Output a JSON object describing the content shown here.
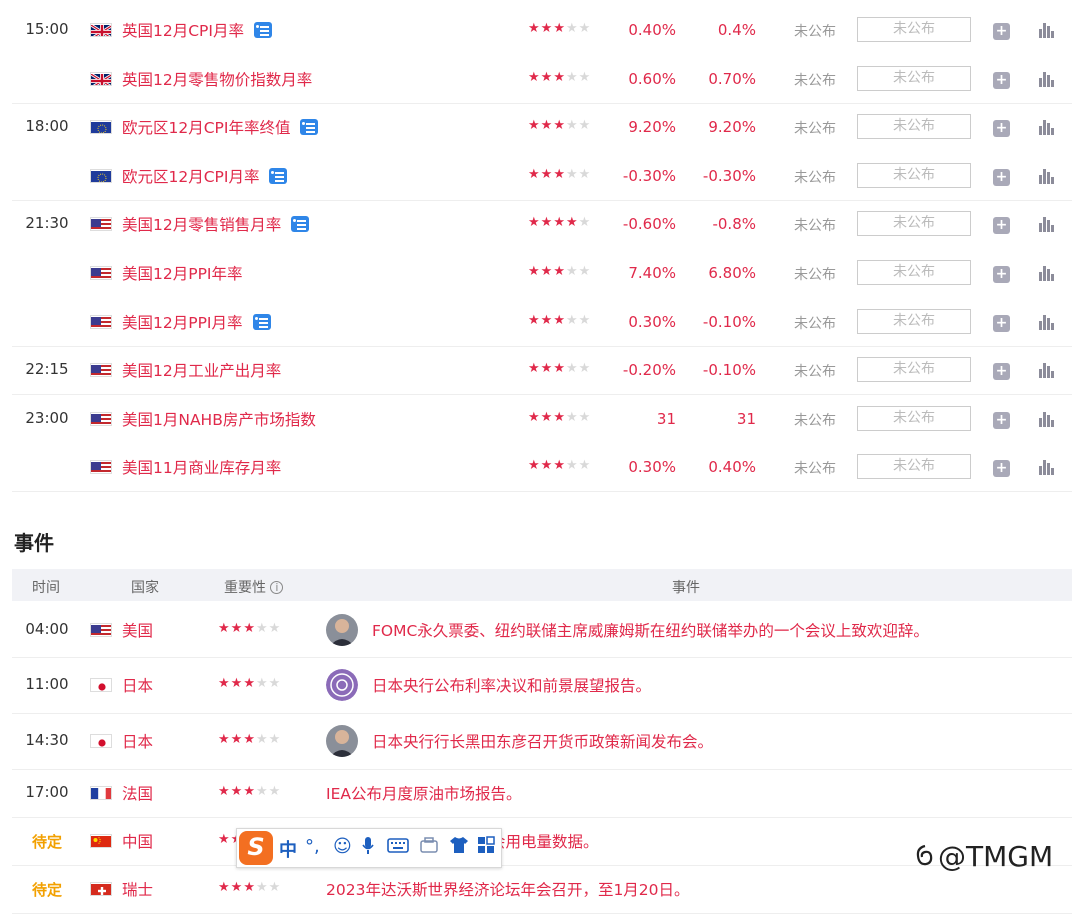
{
  "econ_rows": [
    {
      "time": "15:00",
      "flag": "uk",
      "name": "英国12月CPI月率",
      "tip": true,
      "stars": 3,
      "prev": "0.40%",
      "forecast": "0.4%",
      "actual": "未公布",
      "input": "未公布"
    },
    {
      "time": "",
      "flag": "uk",
      "name": "英国12月零售物价指数月率",
      "tip": false,
      "stars": 3,
      "prev": "0.60%",
      "forecast": "0.70%",
      "actual": "未公布",
      "input": "未公布"
    },
    {
      "time": "18:00",
      "flag": "eu",
      "name": "欧元区12月CPI年率终值",
      "tip": true,
      "stars": 3,
      "prev": "9.20%",
      "forecast": "9.20%",
      "actual": "未公布",
      "input": "未公布"
    },
    {
      "time": "",
      "flag": "eu",
      "name": "欧元区12月CPI月率",
      "tip": true,
      "stars": 3,
      "prev": "-0.30%",
      "forecast": "-0.30%",
      "actual": "未公布",
      "input": "未公布"
    },
    {
      "time": "21:30",
      "flag": "us",
      "name": "美国12月零售销售月率",
      "tip": true,
      "stars": 4,
      "prev": "-0.60%",
      "forecast": "-0.8%",
      "actual": "未公布",
      "input": "未公布"
    },
    {
      "time": "",
      "flag": "us",
      "name": "美国12月PPI年率",
      "tip": false,
      "stars": 3,
      "prev": "7.40%",
      "forecast": "6.80%",
      "actual": "未公布",
      "input": "未公布"
    },
    {
      "time": "",
      "flag": "us",
      "name": "美国12月PPI月率",
      "tip": true,
      "stars": 3,
      "prev": "0.30%",
      "forecast": "-0.10%",
      "actual": "未公布",
      "input": "未公布"
    },
    {
      "time": "22:15",
      "flag": "us",
      "name": "美国12月工业产出月率",
      "tip": false,
      "stars": 3,
      "prev": "-0.20%",
      "forecast": "-0.10%",
      "actual": "未公布",
      "input": "未公布"
    },
    {
      "time": "23:00",
      "flag": "us",
      "name": "美国1月NAHB房产市场指数",
      "tip": false,
      "stars": 3,
      "prev": "31",
      "forecast": "31",
      "actual": "未公布",
      "input": "未公布"
    },
    {
      "time": "",
      "flag": "us",
      "name": "美国11月商业库存月率",
      "tip": false,
      "stars": 3,
      "prev": "0.30%",
      "forecast": "0.40%",
      "actual": "未公布",
      "input": "未公布"
    }
  ],
  "events_section": {
    "title": "事件",
    "headers": {
      "time": "时间",
      "country": "国家",
      "importance": "重要性",
      "event": "事件"
    },
    "rows": [
      {
        "time": "04:00",
        "pending": false,
        "flag": "us",
        "country": "美国",
        "stars": 3,
        "avatar": "person",
        "text": "FOMC永久票委、纽约联储主席威廉姆斯在纽约联储举办的一个会议上致欢迎辞。"
      },
      {
        "time": "11:00",
        "pending": false,
        "flag": "jp",
        "country": "日本",
        "stars": 3,
        "avatar": "seal",
        "text": "日本央行公布利率决议和前景展望报告。"
      },
      {
        "time": "14:30",
        "pending": false,
        "flag": "jp",
        "country": "日本",
        "stars": 3,
        "avatar": "person",
        "text": "日本央行行长黑田东彦召开货币政策新闻发布会。"
      },
      {
        "time": "17:00",
        "pending": false,
        "flag": "fr",
        "country": "法国",
        "stars": 3,
        "avatar": "",
        "text": "IEA公布月度原油市场报告。"
      },
      {
        "time": "待定",
        "pending": true,
        "flag": "cn",
        "country": "中国",
        "stars": 3,
        "avatar": "",
        "text": "发布全社会用电量数据。"
      },
      {
        "time": "待定",
        "pending": true,
        "flag": "ch",
        "country": "瑞士",
        "stars": 3,
        "avatar": "",
        "text": "2023年达沃斯世界经济论坛年会召开，至1月20日。"
      }
    ]
  },
  "ime_toolbar": {
    "logo": "S",
    "mode": "中",
    "punct": "°,",
    "icons": [
      "emoji-icon",
      "mic-icon",
      "keyboard-icon",
      "toolbox-icon",
      "skin-icon",
      "grid-icon"
    ]
  },
  "brand_watermark": "@TMGM",
  "colors": {
    "accent": "#e0294a",
    "pending": "#f2a000",
    "header_bg": "#f1f2f6"
  }
}
